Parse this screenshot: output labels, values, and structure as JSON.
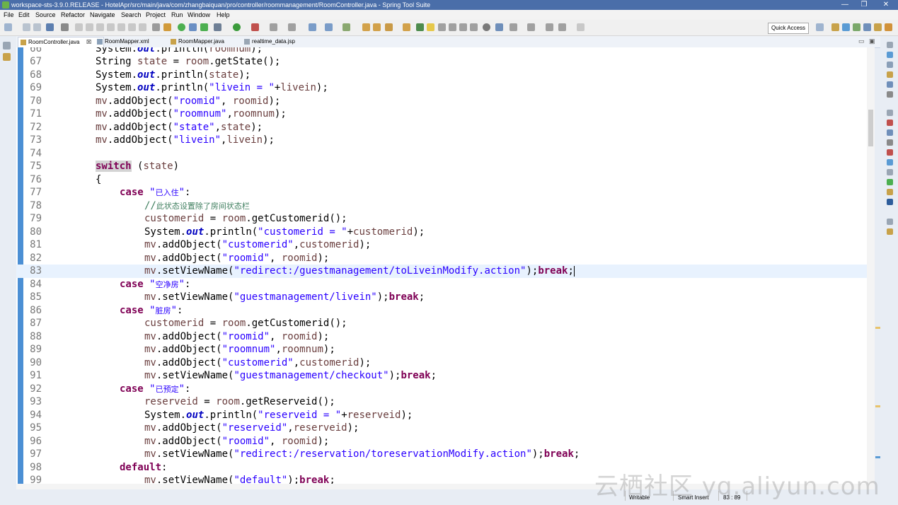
{
  "window": {
    "title": "workspace-sts-3.9.0.RELEASE - HotelApr/src/main/java/com/zhangbaiquan/pro/controller/roommanagement/RoomController.java - Spring Tool Suite",
    "minimize": "—",
    "restore": "❐",
    "close": "✕"
  },
  "menu": [
    "File",
    "Edit",
    "Source",
    "Refactor",
    "Navigate",
    "Search",
    "Project",
    "Run",
    "Window",
    "Help"
  ],
  "toolbar": {
    "quick_access": "Quick Access"
  },
  "tabs": [
    {
      "label": "RoomController.java",
      "close": "☒"
    },
    {
      "label": "RoomMapper.xml"
    },
    {
      "label": "RoomMapper.java"
    },
    {
      "label": "realtime_data.jsp"
    }
  ],
  "editor": {
    "lines": [
      {
        "n": "66",
        "code": "System.out.println(roomnum);"
      },
      {
        "n": "67",
        "code": "String state = room.getState();"
      },
      {
        "n": "68",
        "code": "System.out.println(state);"
      },
      {
        "n": "69",
        "code": "System.out.println(\"livein = \"+livein);"
      },
      {
        "n": "70",
        "code": "mv.addObject(\"roomid\", roomid);"
      },
      {
        "n": "71",
        "code": "mv.addObject(\"roomnum\",roomnum);"
      },
      {
        "n": "72",
        "code": "mv.addObject(\"state\",state);"
      },
      {
        "n": "73",
        "code": "mv.addObject(\"livein\",livein);"
      },
      {
        "n": "74",
        "code": ""
      },
      {
        "n": "75",
        "code": "switch (state)"
      },
      {
        "n": "76",
        "code": "{"
      },
      {
        "n": "77",
        "code": "case \"已入住\":"
      },
      {
        "n": "78",
        "code": "//此状态设置除了房间状态栏"
      },
      {
        "n": "79",
        "code": "customerid = room.getCustomerid();"
      },
      {
        "n": "80",
        "code": "System.out.println(\"customerid = \"+customerid);"
      },
      {
        "n": "81",
        "code": "mv.addObject(\"customerid\",customerid);"
      },
      {
        "n": "82",
        "code": "mv.addObject(\"roomid\", roomid);"
      },
      {
        "n": "83",
        "code": "mv.setViewName(\"redirect:/guestmanagement/toLiveinModify.action\");break;"
      },
      {
        "n": "84",
        "code": "case \"空净房\":"
      },
      {
        "n": "85",
        "code": "mv.setViewName(\"guestmanagement/livein\");break;"
      },
      {
        "n": "86",
        "code": "case \"脏房\":"
      },
      {
        "n": "87",
        "code": "customerid = room.getCustomerid();"
      },
      {
        "n": "88",
        "code": "mv.addObject(\"roomid\", roomid);"
      },
      {
        "n": "89",
        "code": "mv.addObject(\"roomnum\",roomnum);"
      },
      {
        "n": "90",
        "code": "mv.addObject(\"customerid\",customerid);"
      },
      {
        "n": "91",
        "code": "mv.setViewName(\"guestmanagement/checkout\");break;"
      },
      {
        "n": "92",
        "code": "case \"已预定\":"
      },
      {
        "n": "93",
        "code": "reserveid = room.getReserveid();"
      },
      {
        "n": "94",
        "code": "System.out.println(\"reserveid = \"+reserveid);"
      },
      {
        "n": "95",
        "code": "mv.addObject(\"reserveid\",reserveid);"
      },
      {
        "n": "96",
        "code": "mv.addObject(\"roomid\", roomid);"
      },
      {
        "n": "97",
        "code": "mv.setViewName(\"redirect:/reservation/toreservationModify.action\");break;"
      },
      {
        "n": "98",
        "code": "default:"
      },
      {
        "n": "99",
        "code": "mv.setViewName(\"default\");break;"
      }
    ]
  },
  "status": {
    "writable": "Writable",
    "insert_mode": "Smart Insert",
    "position": "83 : 89"
  },
  "watermark": "云栖社区 yq.aliyun.com",
  "colors": {
    "title_bar": "#4a6ea9",
    "keyword": "#7f0055",
    "string": "#2a00ff",
    "field": "#0000c0",
    "comment": "#3f7f5f",
    "current_line": "#e8f2fe"
  }
}
